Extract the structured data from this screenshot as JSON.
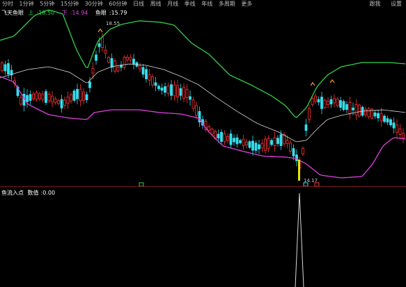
{
  "toolbar": {
    "items": [
      "分时",
      "1分钟",
      "5分钟",
      "15分钟",
      "30分钟",
      "60分钟",
      "日线",
      "周线",
      "月线",
      "季线",
      "年线",
      "多周期",
      "更多"
    ],
    "right_items": [
      "跟我",
      "设置"
    ]
  },
  "main_legend": {
    "indicator": "飞天鱼眼",
    "up_label": "上",
    "up_value": "18.50",
    "down_label": "下",
    "down_value": "14.94",
    "vol_label": "鱼眼",
    "vol_value": "15.79"
  },
  "sub_legend": {
    "indicator": "鱼流入点",
    "value_label": "数值",
    "value": "0.00"
  },
  "annotations": {
    "high_price": "18.55",
    "low_price": "14.17"
  },
  "colors": {
    "up_candle": "#ff3333",
    "down_candle": "#33e0f0",
    "upper_band": "#2dd24a",
    "lower_band": "#e040e0",
    "mid_line": "#d8d8d8",
    "arrow": "#ff9933"
  }
}
